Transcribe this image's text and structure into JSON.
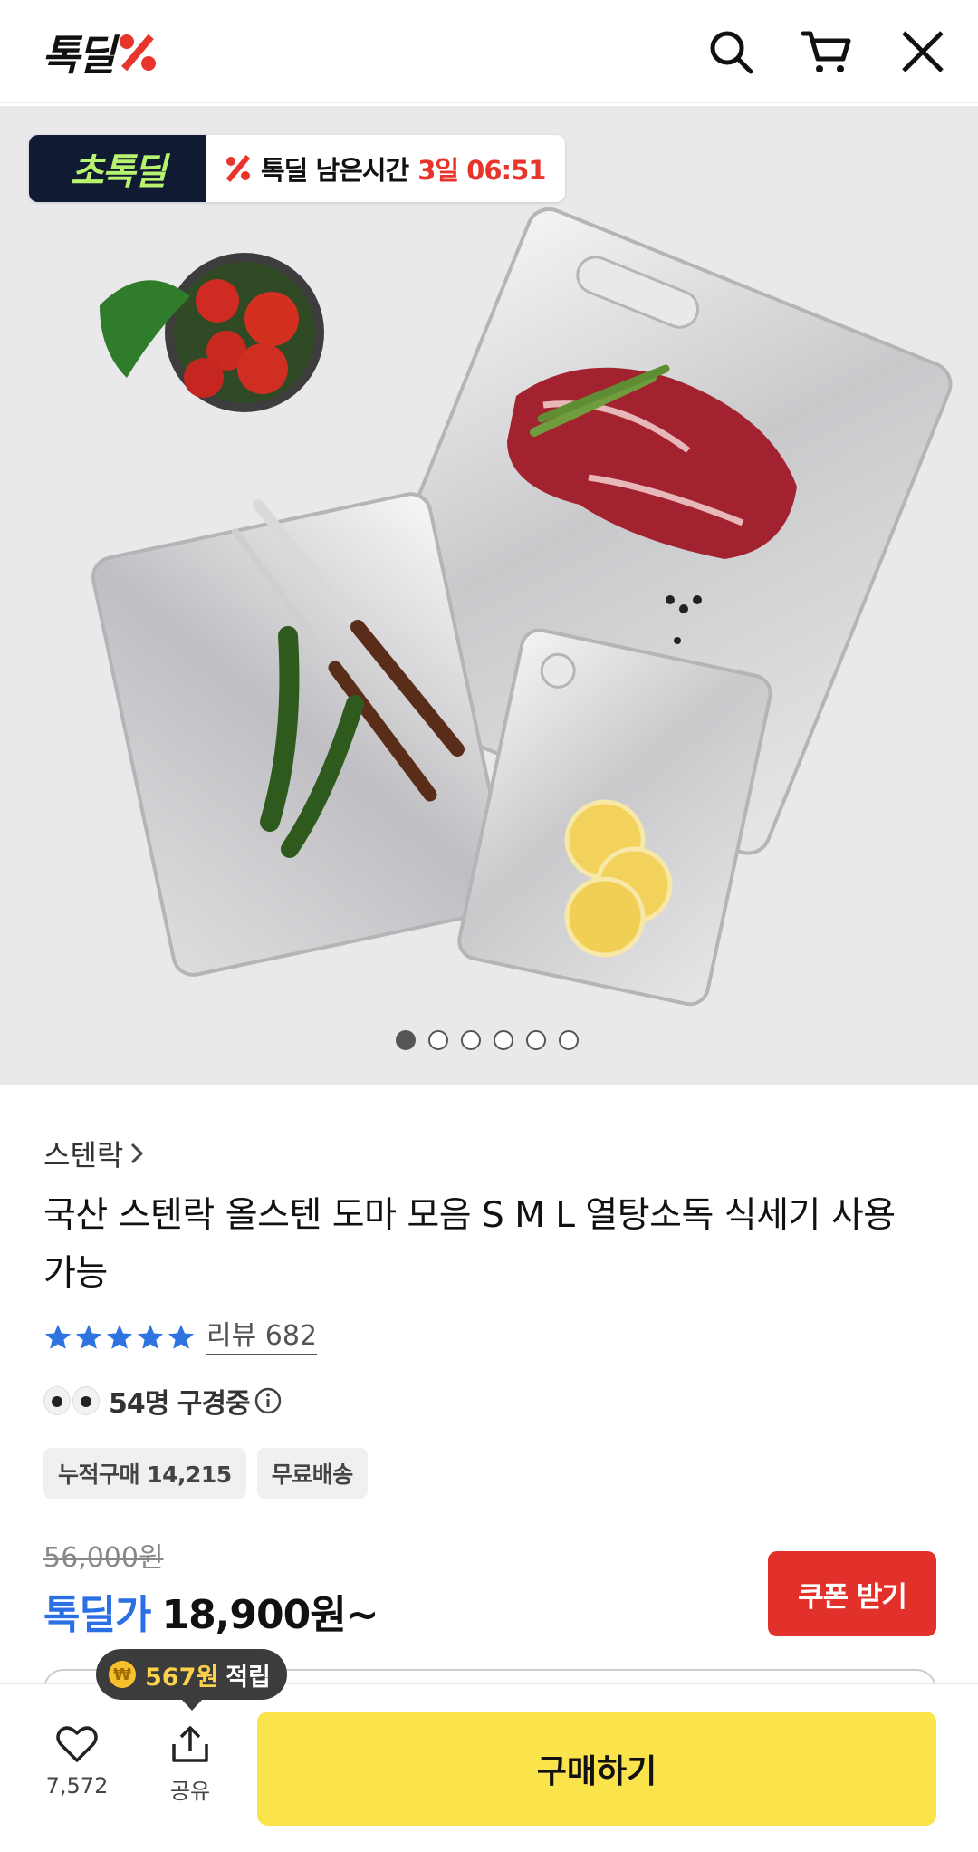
{
  "header": {
    "logo_text": "톡딜",
    "icons": [
      "search-icon",
      "cart-icon",
      "close-icon"
    ]
  },
  "hero": {
    "deal_badge": "초톡딜",
    "deal_label": "톡딜 남은시간",
    "deal_time": "3일 06:51",
    "image_count": 6,
    "active_image": 1
  },
  "product": {
    "brand": "스텐락",
    "title": "국산 스텐락 올스텐 도마 모음 S M L 열탕소독 식세기 사용 가능",
    "rating_stars": 5,
    "review_label": "리뷰 682",
    "viewers": "54명 구경중",
    "chips": [
      "누적구매 14,215",
      "무료배송"
    ],
    "original_price": "56,000원",
    "deal_price_label": "톡딜가",
    "deal_price": "18,900원~",
    "coupon_button": "쿠폰 받기"
  },
  "points_tooltip": {
    "amount": "567원",
    "label": "적립"
  },
  "bottom_bar": {
    "favorite_count": "7,572",
    "share_label": "공유",
    "buy_button": "구매하기"
  },
  "colors": {
    "accent_red": "#e2312b",
    "deal_blue": "#2b6fe4",
    "buy_yellow": "#fbe34b"
  }
}
